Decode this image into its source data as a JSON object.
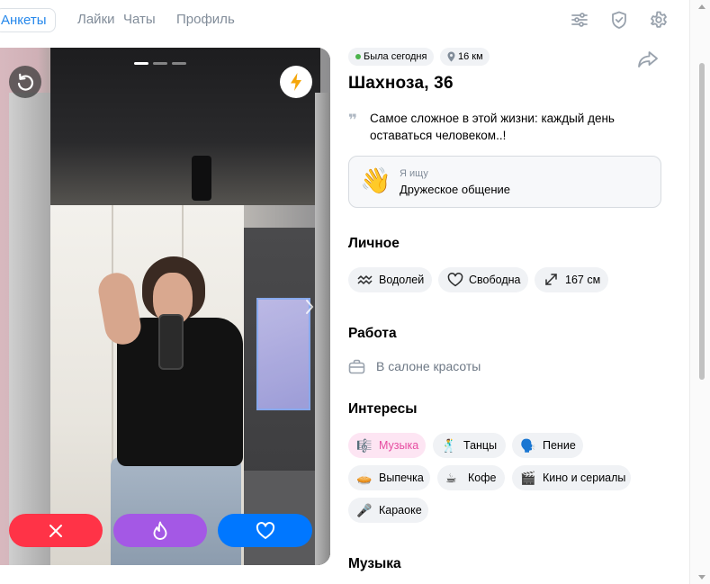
{
  "nav": {
    "tabs": [
      {
        "label": "Анкеты",
        "active": true
      },
      {
        "label": "Лайки"
      },
      {
        "label": "Чаты"
      },
      {
        "label": "Профиль"
      }
    ],
    "icons": [
      "filters-icon",
      "shield-check-icon",
      "gear-icon"
    ]
  },
  "photo": {
    "page_count": 3,
    "current_page": 1,
    "actions": {
      "dislike_color": "#ff3347",
      "superlike_color": "#a458e5",
      "like_color": "#0077ff"
    }
  },
  "profile": {
    "status": "Была сегодня",
    "distance": "16 км",
    "name_age": "Шахноза, 36",
    "bio": "Самое сложное в этой жизни: каждый день оставаться человеком..!",
    "seeking": {
      "emoji": "👋",
      "label": "Я ищу",
      "value": "Дружеское общение"
    },
    "personal": {
      "heading": "Личное",
      "chips": [
        {
          "icon": "aquarius-icon",
          "label": "Водолей"
        },
        {
          "icon": "heart-outline-icon",
          "label": "Свободна"
        },
        {
          "icon": "height-arrows-icon",
          "label": "167 см"
        }
      ]
    },
    "work": {
      "heading": "Работа",
      "icon": "briefcase-icon",
      "value": "В салоне красоты"
    },
    "interests": {
      "heading": "Интересы",
      "chips": [
        {
          "emoji": "🎼",
          "label": "Музыка",
          "highlight": true
        },
        {
          "emoji": "🕺",
          "label": "Танцы"
        },
        {
          "emoji": "🗣️",
          "label": "Пение"
        },
        {
          "emoji": "🥧",
          "label": "Выпечка"
        },
        {
          "emoji": "☕",
          "label": "Кофе"
        },
        {
          "emoji": "🎬",
          "label": "Кино и сериалы"
        },
        {
          "emoji": "🎤",
          "label": "Караоке"
        }
      ]
    },
    "music": {
      "heading": "Музыка"
    }
  },
  "colors": {
    "accent": "#2688eb",
    "online": "#4bb34b",
    "highlight_chip_bg": "#fde5f3",
    "highlight_chip_text": "#e64ca0"
  }
}
